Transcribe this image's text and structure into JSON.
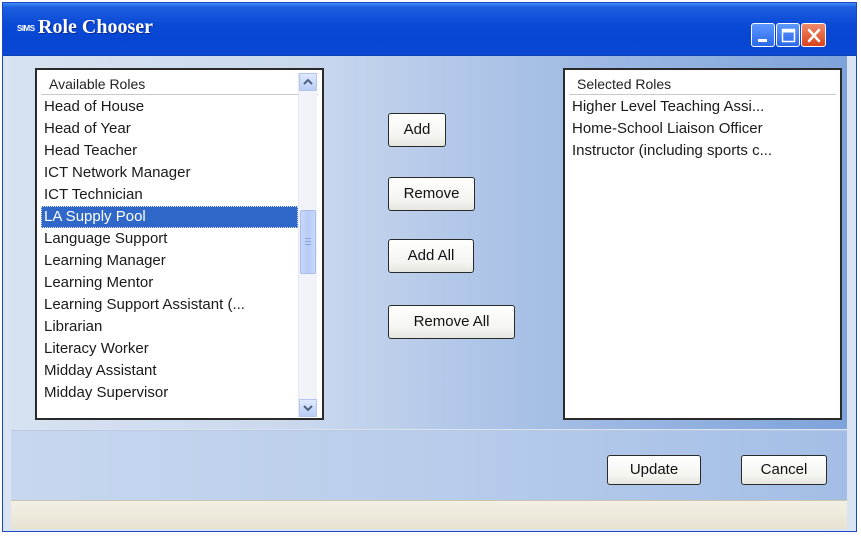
{
  "window": {
    "title": "Role Chooser",
    "app_badge": "SIMS"
  },
  "available_roles": {
    "header": "Available Roles",
    "items": [
      "Head of House",
      "Head of Year",
      "Head Teacher",
      "ICT Network Manager",
      "ICT Technician",
      "LA Supply Pool",
      "Language Support",
      "Learning Manager",
      "Learning Mentor",
      "Learning Support Assistant (...",
      "Librarian",
      "Literacy Worker",
      "Midday Assistant",
      "Midday Supervisor"
    ],
    "selected_item": "LA Supply Pool"
  },
  "selected_roles": {
    "header": "Selected Roles",
    "items": [
      "Higher Level Teaching Assi...",
      "Home-School Liaison Officer",
      "Instructor (including sports c..."
    ]
  },
  "actions": {
    "add": "Add",
    "remove": "Remove",
    "add_all": "Add All",
    "remove_all": "Remove All"
  },
  "footer": {
    "update": "Update",
    "cancel": "Cancel"
  },
  "colors": {
    "titlebar": "#0a4ad6",
    "selection": "#2f68c9",
    "close_button": "#d9421b"
  }
}
